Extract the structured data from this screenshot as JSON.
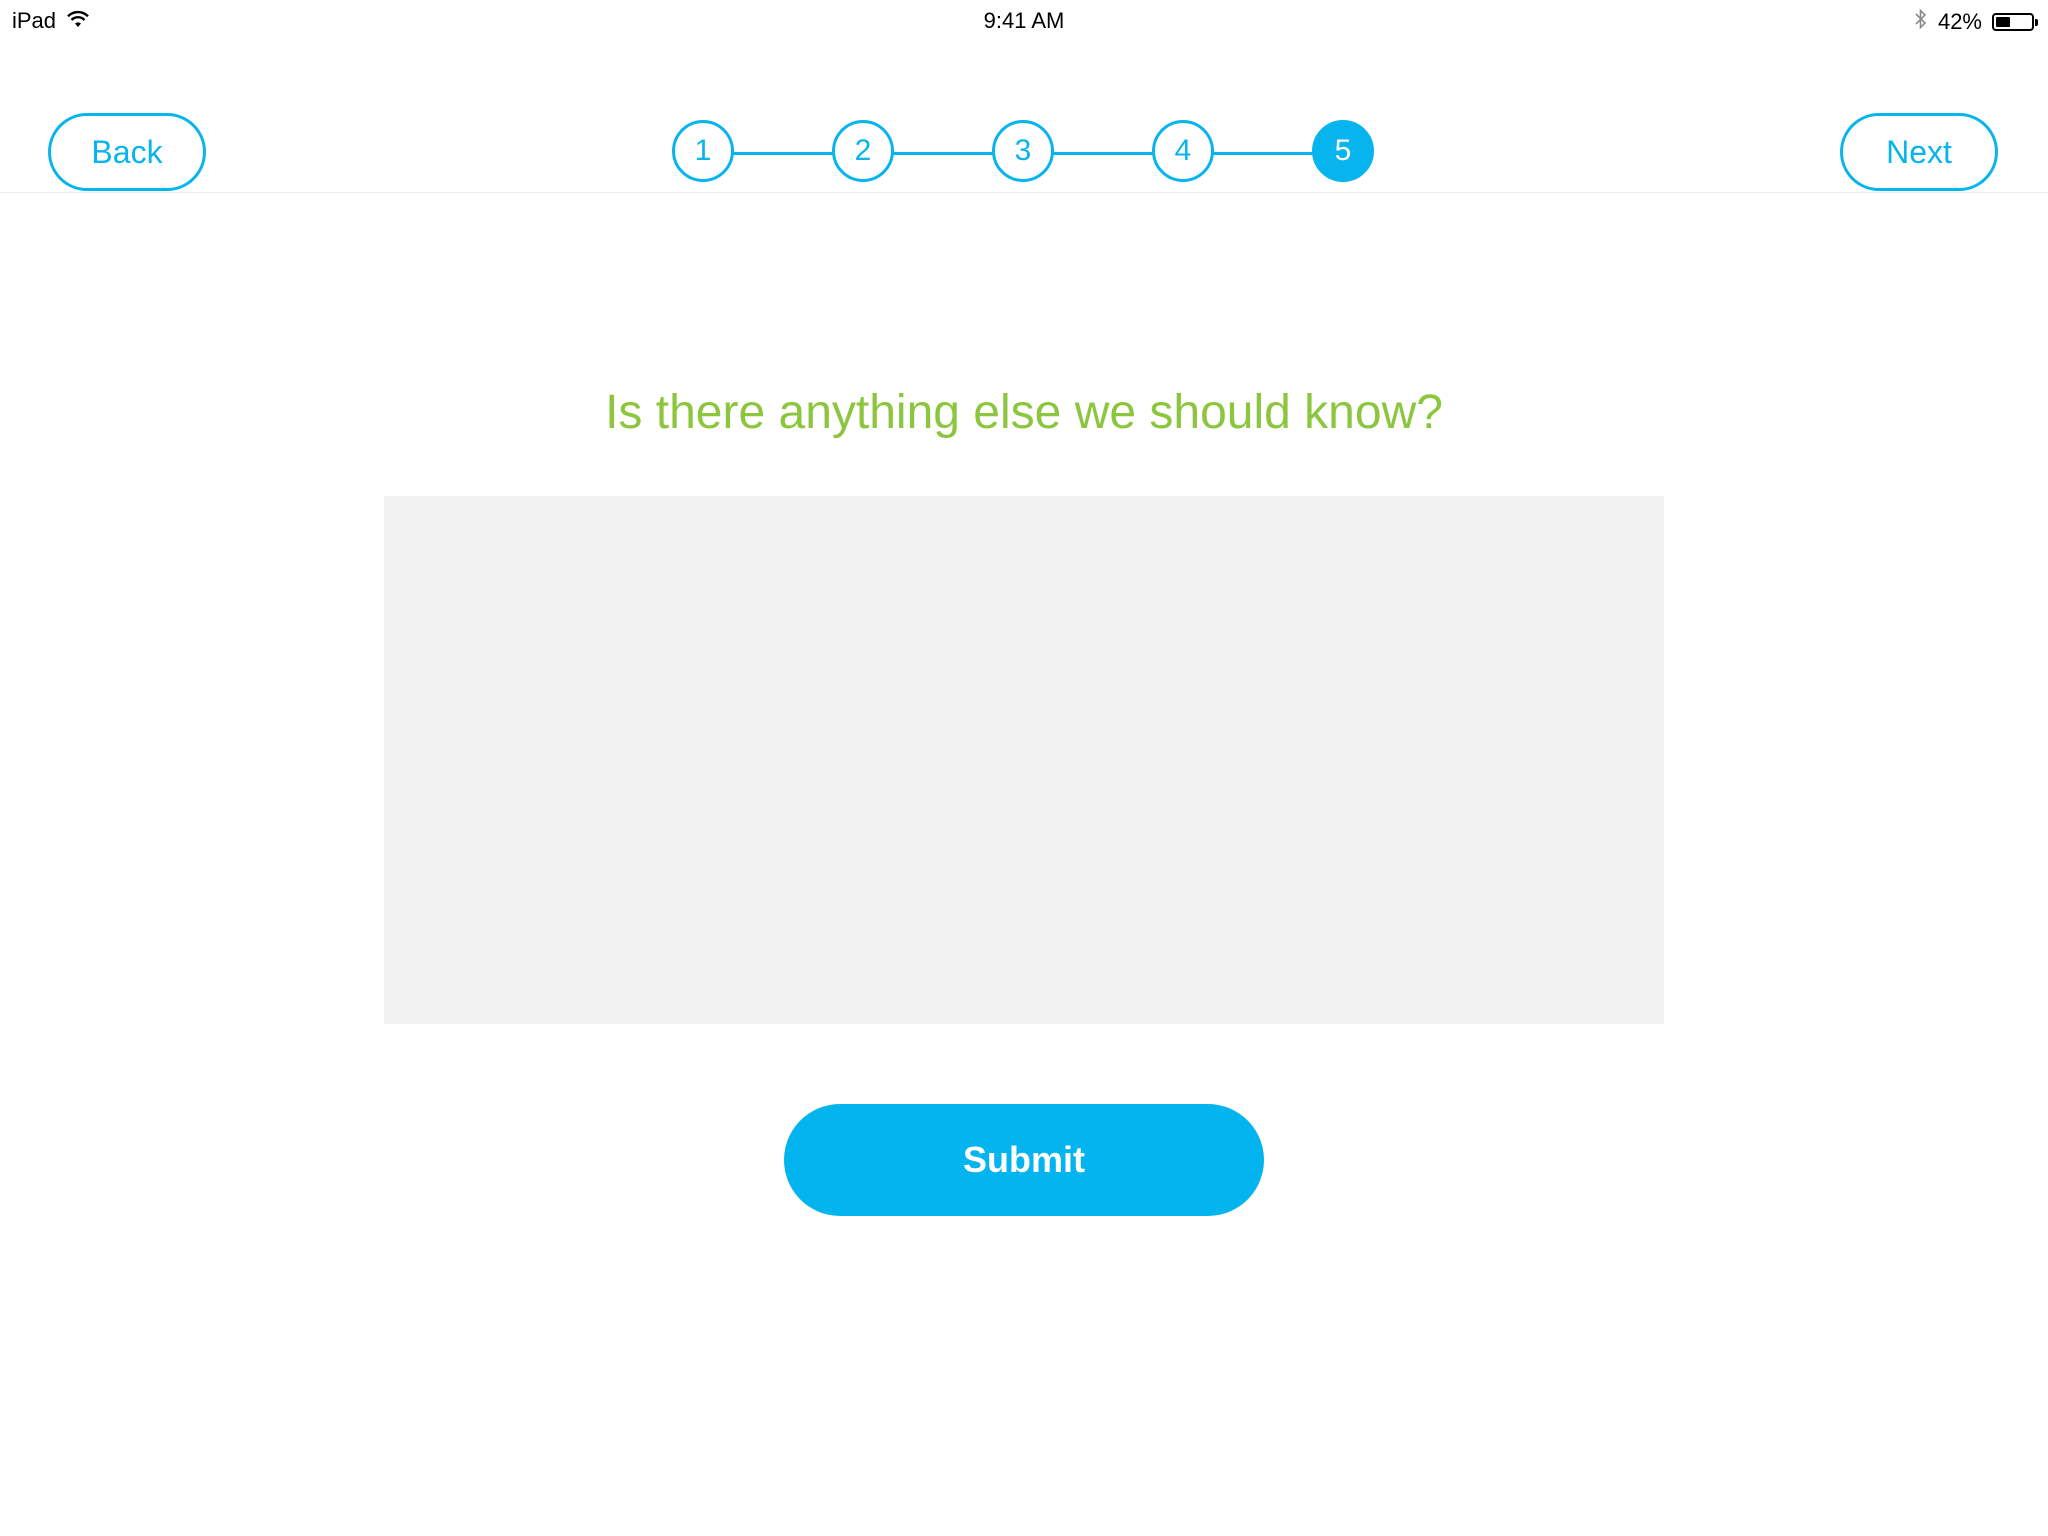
{
  "status_bar": {
    "device": "iPad",
    "time": "9:41 AM",
    "battery_percent_label": "42%",
    "battery_level": 0.42
  },
  "nav": {
    "back_label": "Back",
    "next_label": "Next"
  },
  "stepper": {
    "steps": [
      "1",
      "2",
      "3",
      "4",
      "5"
    ],
    "current_step": 5
  },
  "form": {
    "question": "Is there anything else we should know?",
    "notes_value": "",
    "submit_label": "Submit"
  },
  "colors": {
    "accent_blue": "#08b4ee",
    "question_green": "#8cc63f",
    "textarea_bg": "#f2f2f2"
  },
  "icons": [
    "wifi-icon",
    "bluetooth-icon",
    "battery-icon"
  ]
}
